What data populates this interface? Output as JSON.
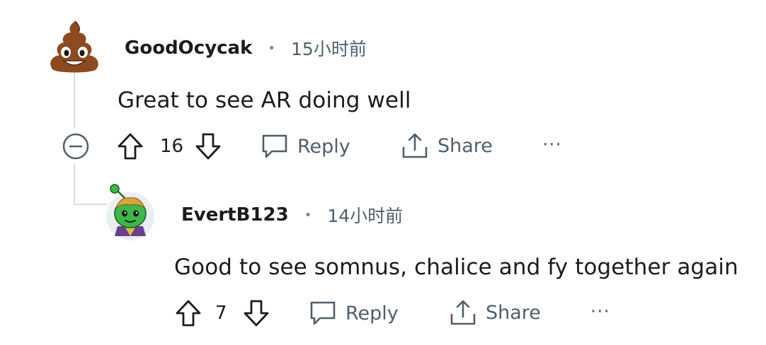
{
  "comments": [
    {
      "author": "GoodOcycak",
      "separator": "•",
      "time": "15小时前",
      "body": "Great to see AR doing well",
      "votes": "16",
      "reply_label": "Reply",
      "share_label": "Share",
      "more_label": "···",
      "avatar_icon": "poop-emoji-icon"
    },
    {
      "author": "EvertB123",
      "separator": "•",
      "time": "14小时前",
      "body": "Good to see somnus, chalice and fy together again",
      "votes": "7",
      "reply_label": "Reply",
      "share_label": "Share",
      "more_label": "···",
      "avatar_icon": "green-snoo-avatar-icon"
    }
  ],
  "colors": {
    "text": "#1c1c1c",
    "meta": "#4f5f6b",
    "thread_line": "#d8dde0",
    "avatar_poop": "#8b4a20",
    "avatar_snoo": "#3cb84a"
  },
  "collapse_icon": "minus-circle-icon"
}
